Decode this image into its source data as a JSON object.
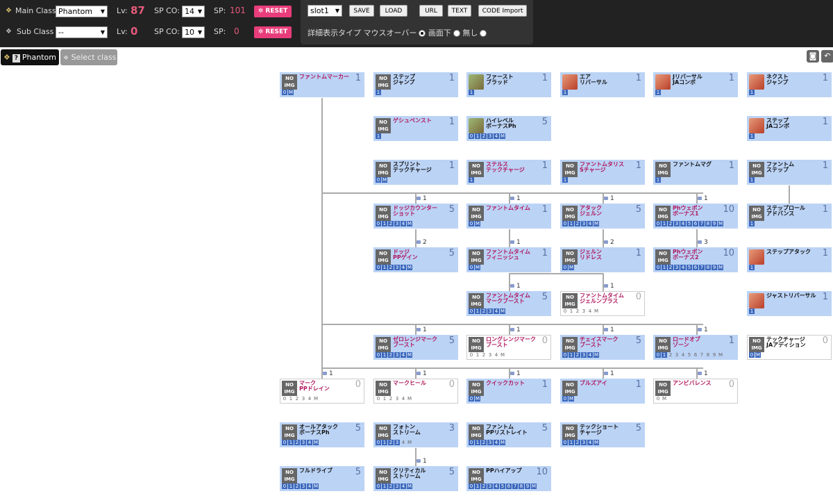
{
  "main": {
    "label": "Main Class",
    "value": "Phantom",
    "lv_label": "Lv:",
    "lv": "87",
    "spco_label": "SP CO:",
    "spco": "14",
    "sp_label": "SP:",
    "sp": "101",
    "reset": "RESET"
  },
  "sub": {
    "label": "Sub  Class",
    "value": "--",
    "lv_label": "Lv:",
    "lv": "0",
    "spco_label": "SP CO:",
    "spco": "10",
    "sp_label": "SP:",
    "sp": "0",
    "reset": "RESET"
  },
  "slot": {
    "value": "slot1",
    "save": "SAVE",
    "load": "LOAD",
    "url": "URL",
    "text": "TEXT",
    "code": "CODE Import"
  },
  "display": {
    "label": "詳細表示タイプ",
    "opt1": "マウスオーバー",
    "opt2": "画面下",
    "opt3": "無し",
    "selected": "マウスオーバー"
  },
  "tabs": {
    "active": "Phantom",
    "select": "Select class"
  },
  "noimg_top": "NO",
  "noimg_bottom": "IMG",
  "skills": [
    {
      "name": "ファントムマーカー",
      "lvl": "1",
      "max": "M",
      "pink": true,
      "noimg": true,
      "pips": "0M",
      "on": "2"
    },
    {
      "name": "ステップ\nジャンプ",
      "lvl": "1",
      "noimg": true,
      "pips": "1",
      "on": "1"
    },
    {
      "name": "ファースト\nブラッド",
      "lvl": "1",
      "icon": "green",
      "pips": "1",
      "on": "1"
    },
    {
      "name": "エア\nリバーサル",
      "lvl": "1",
      "icon": "red",
      "pips": "1",
      "on": "1"
    },
    {
      "name": "Jリバーサル\nJAコンボ",
      "lvl": "1",
      "icon": "red",
      "pips": "1",
      "on": "1"
    },
    {
      "name": "ネクスト\nジャンプ",
      "lvl": "1",
      "icon": "red",
      "pips": "1",
      "on": "1"
    },
    {
      "name": "ゲシュペンスト",
      "lvl": "1",
      "pink": true,
      "noimg": true,
      "pips": "1",
      "on": "1"
    },
    {
      "name": "ハイレベル\nボーナスPh",
      "lvl": "5",
      "icon": "green",
      "pips": "01234M",
      "on": "6"
    },
    {
      "name": "ステップ\nJAコンボ",
      "lvl": "1",
      "icon": "red",
      "pips": "1",
      "on": "1"
    },
    {
      "name": "スプリント\nテックチャージ",
      "lvl": "1",
      "noimg": true,
      "pips": "0M",
      "on": "2"
    },
    {
      "name": "ステルス\nテックチャージ",
      "lvl": "1",
      "pink": true,
      "noimg": true,
      "pips": "1",
      "on": "1"
    },
    {
      "name": "ファントムタリス\nSチャージ",
      "lvl": "1",
      "pink": true,
      "noimg": true,
      "pips": "1",
      "on": "1"
    },
    {
      "name": "ファントムマグ",
      "lvl": "1",
      "noimg": true,
      "pips": "1",
      "on": "1"
    },
    {
      "name": "ファントム\nステップ",
      "lvl": "1",
      "noimg": true,
      "pips": "1",
      "on": "1"
    },
    {
      "name": "ドッジカウンター\nショット",
      "lvl": "5",
      "pink": true,
      "noimg": true,
      "pips": "01234M",
      "on": "6"
    },
    {
      "name": "ファントムタイム",
      "lvl": "1",
      "pink": true,
      "noimg": true,
      "pips": "0M",
      "on": "2"
    },
    {
      "name": "アタック\nジェルン",
      "lvl": "5",
      "pink": true,
      "noimg": true,
      "pips": "01234M",
      "on": "6"
    },
    {
      "name": "Phウェポン\nボーナス1",
      "lvl": "10",
      "pink": true,
      "noimg": true,
      "pips": "0123456789M",
      "on": "11"
    },
    {
      "name": "ステップロール\nアドバンス",
      "lvl": "1",
      "noimg": true,
      "pips": "1",
      "on": "1"
    },
    {
      "name": "ドッジ\nPPゲイン",
      "lvl": "5",
      "pink": true,
      "noimg": true,
      "pips": "01234M",
      "on": "6"
    },
    {
      "name": "ファントムタイム\nフィニッシュ",
      "lvl": "1",
      "pink": true,
      "noimg": true,
      "pips": "0M",
      "on": "2"
    },
    {
      "name": "ジェルン\nリドレス",
      "lvl": "1",
      "pink": true,
      "noimg": true,
      "pips": "0M",
      "on": "2"
    },
    {
      "name": "Phウェポン\nボーナス2",
      "lvl": "10",
      "pink": true,
      "noimg": true,
      "pips": "0123456789M",
      "on": "11"
    },
    {
      "name": "ステップアタック",
      "lvl": "1",
      "icon": "red",
      "pips": "1",
      "on": "1"
    },
    {
      "name": "ファントムタイム\nマークブースト",
      "lvl": "5",
      "pink": true,
      "noimg": true,
      "pips": "01234M",
      "on": "6"
    },
    {
      "name": "ファントムタイム\nジェルンプラス",
      "lvl": "0",
      "pink": true,
      "noimg": true,
      "off": true,
      "pips": "01234M",
      "on": "0"
    },
    {
      "name": "ジャストリバーサル",
      "lvl": "1",
      "icon": "red",
      "pips": "1",
      "on": "1"
    },
    {
      "name": "ゼロレンジマーク\nブースト",
      "lvl": "5",
      "pink": true,
      "noimg": true,
      "pips": "01234M",
      "on": "6"
    },
    {
      "name": "ロングレンジマーク\nブースト",
      "lvl": "0",
      "pink": true,
      "noimg": true,
      "off": true,
      "pips": "01234M",
      "on": "0"
    },
    {
      "name": "チェイスマーク\nブースト",
      "lvl": "5",
      "pink": true,
      "noimg": true,
      "pips": "01234M",
      "on": "6"
    },
    {
      "name": "ロードオブ\nゾーン",
      "lvl": "1",
      "pink": true,
      "noimg": true,
      "pips": "0123456789M",
      "on": "2"
    },
    {
      "name": "テックチャージ\nJAアディション",
      "lvl": "0",
      "noimg": true,
      "off": true,
      "pips": "0M",
      "on": "2"
    },
    {
      "name": "マーク\nPPドレイン",
      "lvl": "0",
      "pink": true,
      "noimg": true,
      "off": true,
      "pips": "01234M",
      "on": "0"
    },
    {
      "name": "マークヒール",
      "lvl": "0",
      "pink": true,
      "noimg": true,
      "off": true,
      "pips": "01234M",
      "on": "0"
    },
    {
      "name": "クイックカット",
      "lvl": "1",
      "pink": true,
      "noimg": true,
      "pips": "0M",
      "on": "2"
    },
    {
      "name": "ブルズアイ",
      "lvl": "1",
      "pink": true,
      "noimg": true,
      "pips": "0M",
      "on": "2"
    },
    {
      "name": "アンビバレンス",
      "lvl": "0",
      "pink": true,
      "noimg": true,
      "off": true,
      "pips": "0M",
      "on": "0"
    },
    {
      "name": "オールアタック\nボーナスPh",
      "lvl": "5",
      "noimg": true,
      "pips": "01234M",
      "on": "6"
    },
    {
      "name": "フォトン\nストリーム",
      "lvl": "3",
      "noimg": true,
      "pips": "01234M",
      "on": "4"
    },
    {
      "name": "ファントム\nPPリストレイト",
      "lvl": "5",
      "noimg": true,
      "pips": "01234M",
      "on": "6"
    },
    {
      "name": "テックショート\nチャージ",
      "lvl": "5",
      "noimg": true,
      "pips": "01234M",
      "on": "6"
    },
    {
      "name": "フルドライブ",
      "lvl": "5",
      "noimg": true,
      "pips": "01234M",
      "on": "6"
    },
    {
      "name": "クリティカル\nストリーム",
      "lvl": "5",
      "noimg": true,
      "pips": "01234M",
      "on": "6"
    },
    {
      "name": "PPハイアップ",
      "lvl": "10",
      "noimg": true,
      "pips": "0123456789M",
      "on": "11"
    }
  ],
  "locks": [
    "1",
    "1",
    "1",
    "1",
    "2",
    "1",
    "2",
    "3",
    "1",
    "1",
    "1",
    "1",
    "1",
    "1",
    "1",
    "1",
    "1",
    "1",
    "1",
    "1",
    "1"
  ]
}
